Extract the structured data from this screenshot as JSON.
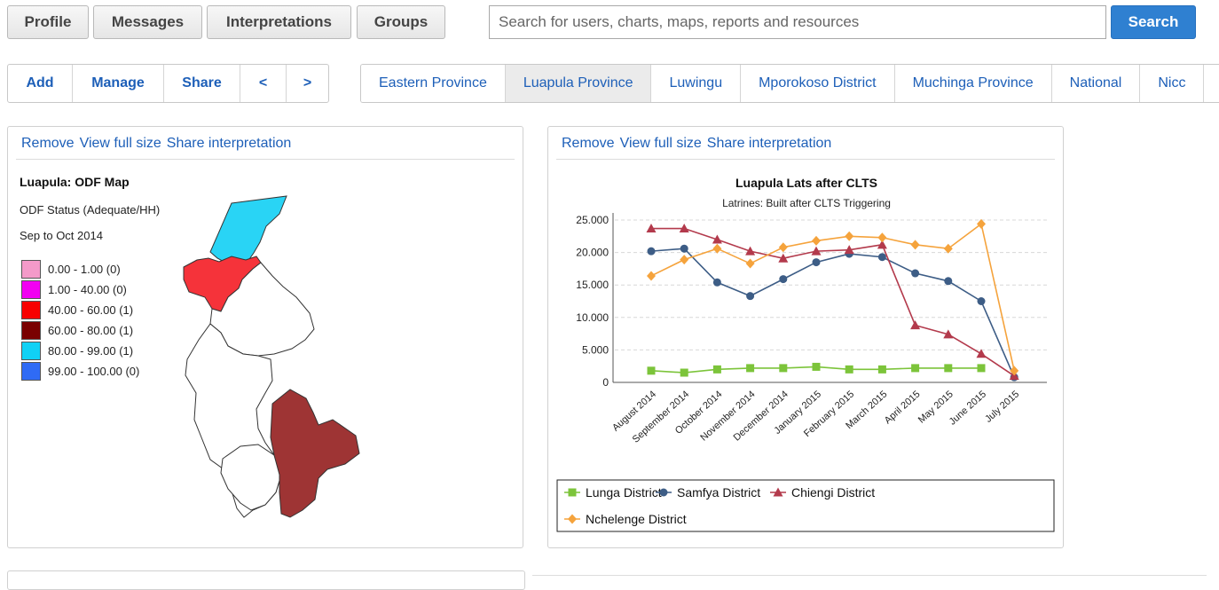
{
  "nav": {
    "profile": "Profile",
    "messages": "Messages",
    "interpretations": "Interpretations",
    "groups": "Groups",
    "search_placeholder": "Search for users, charts, maps, reports and resources",
    "search_button": "Search"
  },
  "toolbar": {
    "add": "Add",
    "manage": "Manage",
    "share": "Share",
    "prev": "<",
    "next": ">"
  },
  "tabs": [
    "Eastern Province",
    "Luapula Province",
    "Luwingu",
    "Mporokoso District",
    "Muchinga Province",
    "National",
    "Nicc"
  ],
  "active_tab": "Luapula Province",
  "actions": {
    "remove": "Remove",
    "view_full_size": "View full size",
    "share_interpretation": "Share interpretation"
  },
  "map_panel": {
    "title": "Luapula: ODF Map",
    "subtitle": "ODF Status (Adequate/HH)",
    "period": "Sep to Oct 2014",
    "legend": [
      {
        "label": "0.00 - 1.00 (0)",
        "color": "#f49ac9"
      },
      {
        "label": "1.00 - 40.00 (0)",
        "color": "#f200f2"
      },
      {
        "label": "40.00 - 60.00 (1)",
        "color": "#f80000"
      },
      {
        "label": "60.00 - 80.00 (1)",
        "color": "#7a0000"
      },
      {
        "label": "80.00 - 99.00 (1)",
        "color": "#10d1f5"
      },
      {
        "label": "99.00 - 100.00 (0)",
        "color": "#2f6bf5"
      }
    ],
    "region_colors": {
      "north": "#29d4f5",
      "upper": "#f5333a",
      "south": "#9e3434",
      "other": "#ffffff"
    }
  },
  "chart_data": {
    "type": "line",
    "title": "Luapula Lats after CLTS",
    "subtitle": "Latrines: Built after CLTS Triggering",
    "categories": [
      "August 2014",
      "September 2014",
      "October 2014",
      "November 2014",
      "December 2014",
      "January 2015",
      "February 2015",
      "March 2015",
      "April 2015",
      "May 2015",
      "June 2015",
      "July 2015"
    ],
    "yticks": [
      "0",
      "5.000",
      "10.000",
      "15.000",
      "20.000",
      "25.000"
    ],
    "ylim": [
      0,
      25000
    ],
    "grid": true,
    "legend_position": "bottom",
    "series": [
      {
        "name": "Lunga District",
        "color": "#7cc43a",
        "marker": "square",
        "values": [
          1800,
          1500,
          2000,
          2200,
          2200,
          2400,
          2000,
          2000,
          2200,
          2200,
          2200,
          null
        ]
      },
      {
        "name": "Samfya District",
        "color": "#3d5d86",
        "marker": "circle",
        "values": [
          20200,
          20600,
          15400,
          13300,
          15900,
          18500,
          19800,
          19300,
          16800,
          15600,
          12500,
          800
        ]
      },
      {
        "name": "Chiengi District",
        "color": "#b33a4c",
        "marker": "triangle",
        "values": [
          23700,
          23700,
          22000,
          20200,
          19100,
          20200,
          20400,
          21200,
          8800,
          7400,
          4400,
          1000
        ]
      },
      {
        "name": "Nchelenge District",
        "color": "#f5a33c",
        "marker": "diamond",
        "values": [
          16400,
          18900,
          20600,
          18300,
          20800,
          21800,
          22500,
          22300,
          21200,
          20600,
          24400,
          1800
        ]
      }
    ]
  }
}
